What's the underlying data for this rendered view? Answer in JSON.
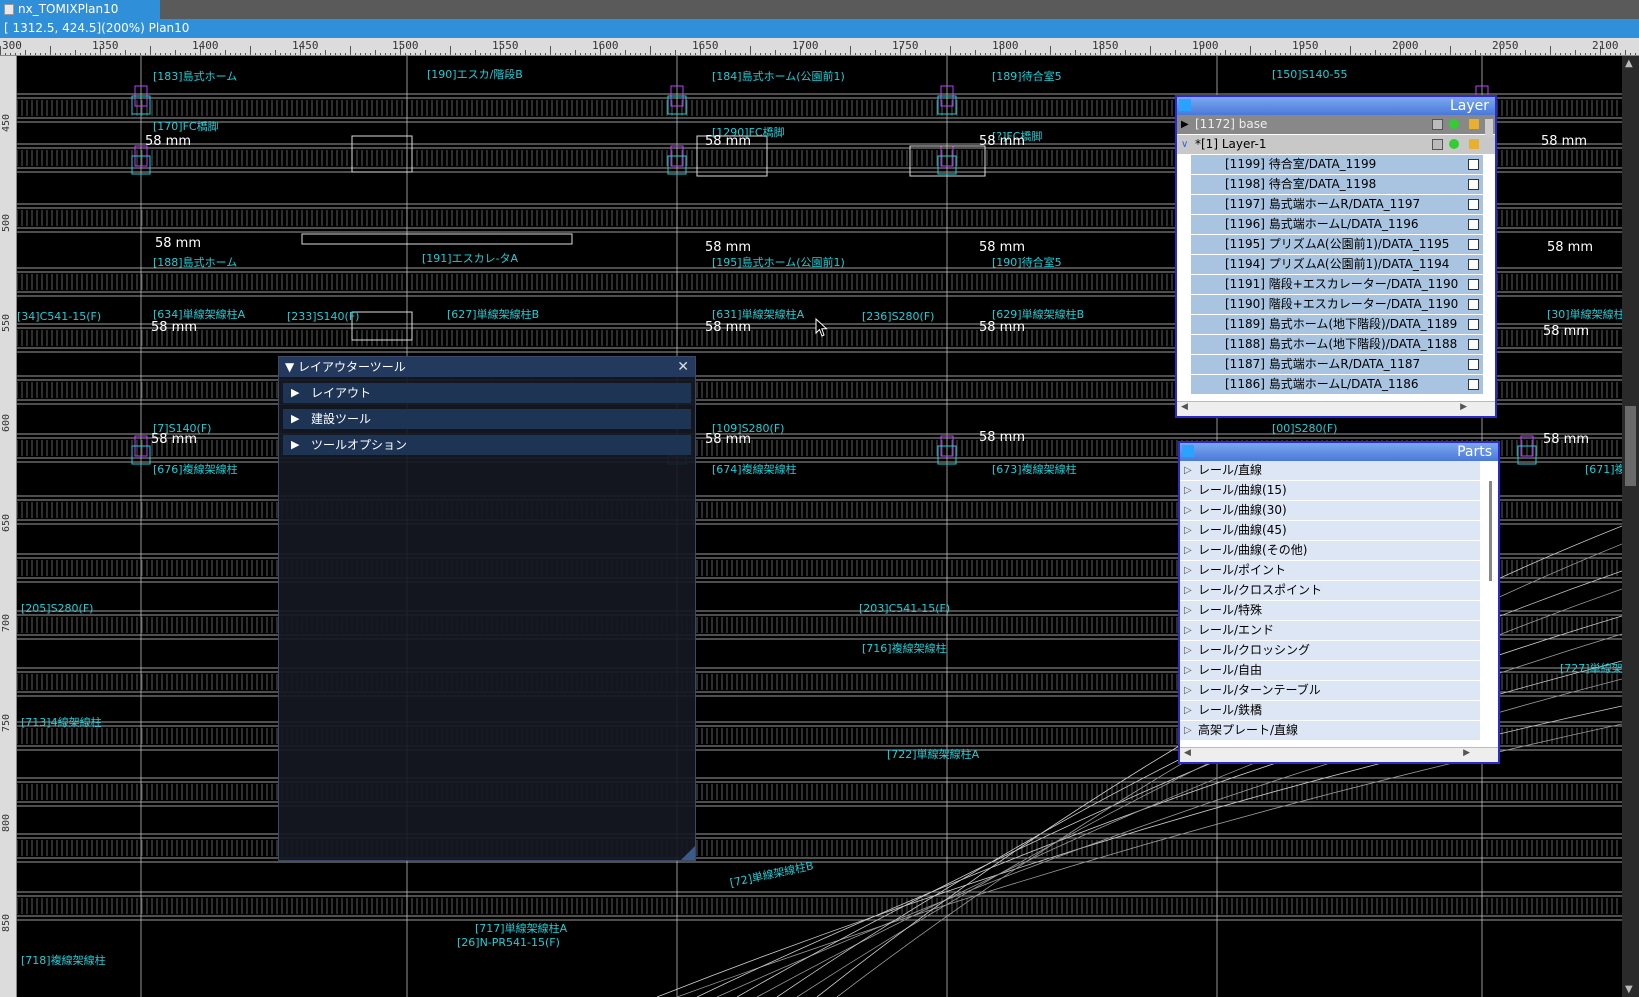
{
  "window": {
    "tab_title": "nx_TOMIXPlan10"
  },
  "status": {
    "text": "[ 1312.5,  424.5](200%) Plan10"
  },
  "ruler_h": [
    "300",
    "1350",
    "1400",
    "1450",
    "1500",
    "1550",
    "1600",
    "1650",
    "1700",
    "1750",
    "1800",
    "1850",
    "1900",
    "1950",
    "2000",
    "2050",
    "2100"
  ],
  "ruler_v": [
    "450",
    "500",
    "550",
    "600",
    "650",
    "700",
    "750",
    "800",
    "850"
  ],
  "canvas_labels": [
    "[183]島式ホーム",
    "[190]エスカ/階段B",
    "[184]島式ホーム(公園前1)",
    "[189]待合室5",
    "[150]S140-55",
    "[170]FC橋脚",
    "[1290]FC橋脚",
    "[?]FC橋脚",
    "[188]島式ホーム",
    "[191]エスカレ-タA",
    "[195]島式ホーム(公園前1)",
    "[190]待合室5",
    "[34]C541-15(F)",
    "[634]単線架線柱A",
    "[233]S140(F)",
    "[627]単線架線柱B",
    "[631]単線架線柱A",
    "[236]S280(F)",
    "[629]単線架線柱B",
    "[30]単線架線柱",
    "[7]S140(F)",
    "[109]S280(F)",
    "[00]S280(F)",
    "[676]複線架線柱",
    "[674]複線架線柱",
    "[673]複線架線柱",
    "[671]複",
    "[205]S280(F)",
    "[203]C541-15(F)",
    "[716]複線架線柱",
    "[727]単線架",
    "[713]4線架線柱",
    "[722]単線架線柱A",
    "[717]単線架線柱A",
    "[718]複線架線柱",
    "[26]N-PR541-15(F)",
    "[72]単線架線柱B"
  ],
  "mm_labels": [
    "58 mm"
  ],
  "tool_panel": {
    "title": "レイアウターツール",
    "sections": [
      "レイアウト",
      "建設ツール",
      "ツールオプション"
    ]
  },
  "layer_panel": {
    "title": "Layer",
    "base": "[1172] base",
    "layer1": "*[1] Layer-1",
    "items": [
      "[1199] 待合室/DATA_1199",
      "[1198] 待合室/DATA_1198",
      "[1197] 島式端ホームR/DATA_1197",
      "[1196] 島式端ホームL/DATA_1196",
      "[1195] プリズムA(公園前1)/DATA_1195",
      "[1194] プリズムA(公園前1)/DATA_1194",
      "[1191] 階段+エスカレーター/DATA_1190",
      "[1190] 階段+エスカレーター/DATA_1190",
      "[1189] 島式ホーム(地下階段)/DATA_1189",
      "[1188] 島式ホーム(地下階段)/DATA_1188",
      "[1187] 島式端ホームR/DATA_1187",
      "[1186] 島式端ホームL/DATA_1186"
    ]
  },
  "parts_panel": {
    "title": "Parts",
    "items": [
      "レール/直線",
      "レール/曲線(15)",
      "レール/曲線(30)",
      "レール/曲線(45)",
      "レール/曲線(その他)",
      "レール/ポイント",
      "レール/クロスポイント",
      "レール/特殊",
      "レール/エンド",
      "レール/クロッシング",
      "レール/自由",
      "レール/ターンテーブル",
      "レール/鉄橋",
      "高架プレート/直線"
    ]
  },
  "colors": {
    "accent": "#2f8fd8",
    "cad_cyan": "#1ecfd8",
    "cad_magenta": "#c040ff",
    "track": "#cfcfcf"
  }
}
